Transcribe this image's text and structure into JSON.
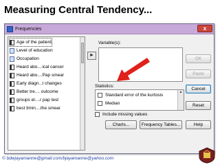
{
  "slide": {
    "title": "Measuring Central Tendency...",
    "footer": "© bdwjayamanne@gmail.com/bjayamanne@yahoo.com"
  },
  "dialog": {
    "title": "Frequencies",
    "close_label": "x",
    "variables": [
      {
        "label": "Age of the patient",
        "icon": "scale-variable-icon",
        "selected": true
      },
      {
        "label": "Level of education",
        "icon": "ordinal-variable-icon"
      },
      {
        "label": "Occupation",
        "icon": "nominal-variable-icon"
      },
      {
        "label": "Heard abo....ical cancer",
        "icon": "scale-variable-icon"
      },
      {
        "label": "Heard abo....Pap smear",
        "icon": "scale-variable-icon"
      },
      {
        "label": "Early diagn...l changes",
        "icon": "scale-variable-icon"
      },
      {
        "label": "Better tre.... outcome",
        "icon": "scale-variable-icon"
      },
      {
        "label": "groups el....r pap test",
        "icon": "scale-variable-icon"
      },
      {
        "label": "best timin....the smear",
        "icon": "scale-variable-icon"
      }
    ],
    "move_arrow_label": "►",
    "variables_label": "Variable(s):",
    "statistics_label": "Statistics:",
    "statistics_items": [
      {
        "label": "Standard error of the kurtosis",
        "checked": false
      },
      {
        "label": "Median",
        "checked": false
      }
    ],
    "include_missing_label": "Include missing values",
    "buttons": {
      "ok": "OK",
      "paste": "Paste",
      "cancel": "Cancel",
      "reset": "Reset",
      "help": "Help",
      "charts": "Charts...",
      "frequency_tables": "Frequency Tables..."
    },
    "colors": {
      "titlebar": "#c7a9d9",
      "annotation_arrow": "#e0201b"
    }
  }
}
